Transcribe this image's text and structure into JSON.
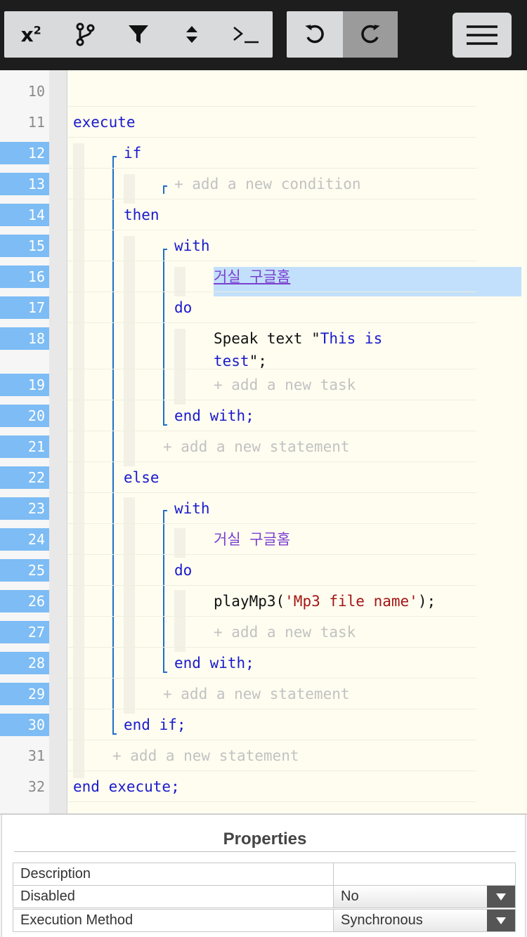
{
  "toolbar": {
    "buttons": [
      {
        "name": "superscript-icon",
        "label": "x",
        "sup": "2"
      },
      {
        "name": "branch-icon"
      },
      {
        "name": "filter-icon"
      },
      {
        "name": "sort-icon"
      },
      {
        "name": "terminal-icon"
      }
    ],
    "undo": "undo-icon",
    "redo": "redo-icon",
    "menu": "hamburger-menu-icon"
  },
  "lines": [
    {
      "n": "10"
    },
    {
      "n": "11"
    },
    {
      "n": "12"
    },
    {
      "n": "13"
    },
    {
      "n": "14"
    },
    {
      "n": "15"
    },
    {
      "n": "16"
    },
    {
      "n": "17"
    },
    {
      "n": "18"
    },
    {
      "n": "19"
    },
    {
      "n": "20"
    },
    {
      "n": "21"
    },
    {
      "n": "22"
    },
    {
      "n": "23"
    },
    {
      "n": "24"
    },
    {
      "n": "25"
    },
    {
      "n": "26"
    },
    {
      "n": "27"
    },
    {
      "n": "28"
    },
    {
      "n": "29"
    },
    {
      "n": "30"
    },
    {
      "n": "31"
    },
    {
      "n": "32"
    }
  ],
  "code": {
    "execute": "execute",
    "if": "if",
    "add_condition": "+ add a new condition",
    "then": "then",
    "with1": "with",
    "device1": "거실 구글홈",
    "do1": "do",
    "speak_prefix": "Speak text \"",
    "speak_str1": "This is",
    "speak_str2": "test",
    "speak_suffix": "\";",
    "add_task1": "+ add a new task",
    "end_with1": "end with;",
    "add_statement1": "+ add a new statement",
    "else": "else",
    "with2": "with",
    "device2": "거실 구글홈",
    "do2": "do",
    "play_fn": "playMp3(",
    "play_arg": "'Mp3 file name'",
    "play_end": ");",
    "add_task2": "+ add a new task",
    "end_with2": "end with;",
    "add_statement2": "+ add a new statement",
    "end_if": "end if;",
    "add_statement3": "+ add a new statement",
    "end_execute": "end execute;"
  },
  "properties": {
    "title": "Properties",
    "rows": [
      {
        "label": "Description",
        "value": ""
      },
      {
        "label": "Disabled",
        "value": "No"
      },
      {
        "label": "Execution Method",
        "value": "Synchronous"
      }
    ]
  },
  "colors": {
    "keyword": "#1a1acc",
    "string": "#a31515",
    "device": "#7b3fd0",
    "selected_line": "#7dbcf4",
    "placeholder": "#c2c2c2"
  }
}
